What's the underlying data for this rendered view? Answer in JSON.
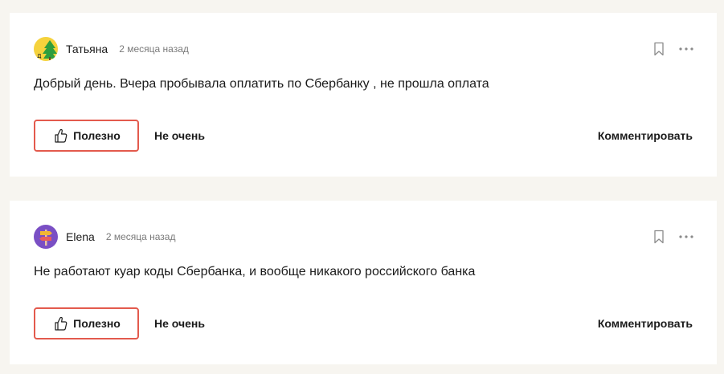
{
  "reviews": [
    {
      "author": "Татьяна",
      "date": "2 месяца назад",
      "text": "Добрый день. Вчера пробывала оплатить по Сбербанку , не прошла оплата",
      "useful_label": "Полезно",
      "not_useful_label": "Не очень",
      "comment_label": "Комментировать",
      "avatar_initial": "Д"
    },
    {
      "author": "Elena",
      "date": "2 месяца назад",
      "text": "Не работают куар коды Сбербанка, и вообще никакого российского банка",
      "useful_label": "Полезно",
      "not_useful_label": "Не очень",
      "comment_label": "Комментировать"
    }
  ],
  "colors": {
    "background": "#f7f5f0",
    "card": "#ffffff",
    "accent_border": "#e35a4d",
    "secondary_text": "#7a7a7a"
  },
  "icons": {
    "avatar_1": "tree-avatar",
    "avatar_2": "signpost-avatar",
    "bookmark": "bookmark-icon",
    "more": "more-icon",
    "thumb": "thumb-up-icon"
  }
}
